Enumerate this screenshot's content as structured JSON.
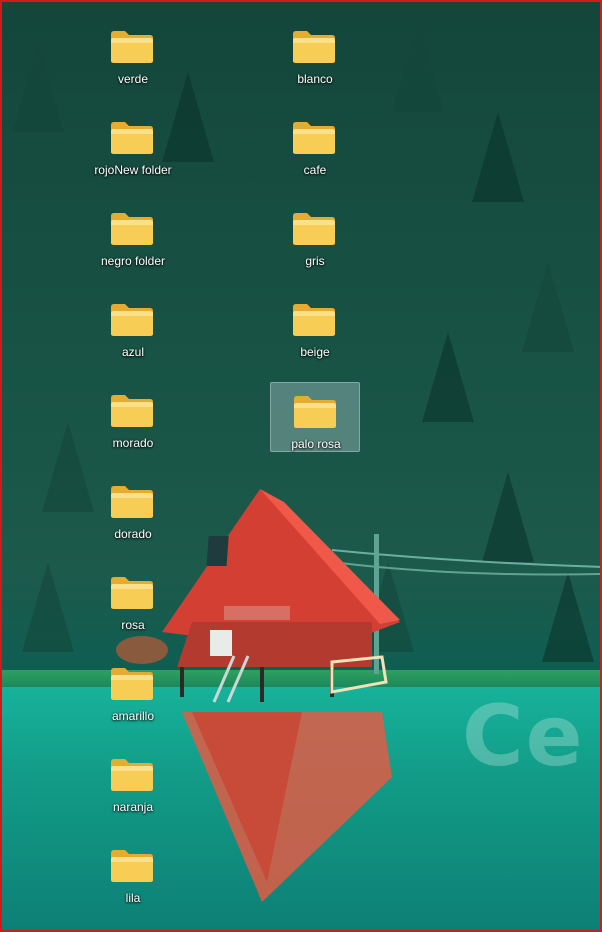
{
  "desktop": {
    "wallpaper_watermark": "Ce",
    "icons": [
      {
        "label": "verde"
      },
      {
        "label": "rojoNew folder"
      },
      {
        "label": "negro folder"
      },
      {
        "label": "azul"
      },
      {
        "label": "morado"
      },
      {
        "label": "dorado"
      },
      {
        "label": "rosa"
      },
      {
        "label": "amarillo"
      },
      {
        "label": "naranja"
      },
      {
        "label": "lila"
      },
      {
        "label": "blanco"
      },
      {
        "label": "cafe"
      },
      {
        "label": "gris"
      },
      {
        "label": "beige"
      },
      {
        "label": "palo rosa",
        "selected": true
      }
    ]
  },
  "colors": {
    "frame_border": "#d11a1a",
    "folder_body": "#f7cd56",
    "folder_back": "#e6ac2f",
    "selection_tint": "#cde1eb"
  },
  "icon_name": "folder-icon"
}
